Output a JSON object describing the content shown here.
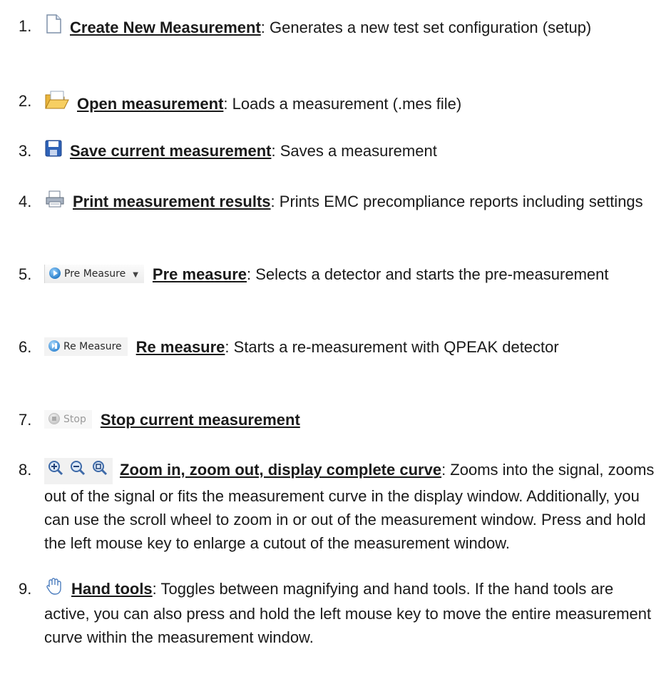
{
  "items": [
    {
      "num": "1.",
      "title": "Create New Measurement",
      "desc": ": Generates a new test set configuration (setup)",
      "icon": "new-document-icon"
    },
    {
      "num": "2.",
      "title": "Open measurement",
      "desc": ": Loads a measurement (.mes file)",
      "icon": "open-folder-icon"
    },
    {
      "num": "3.",
      "title": "Save current measurement",
      "desc": ": Saves a measurement",
      "icon": "floppy-disk-icon"
    },
    {
      "num": "4.",
      "title": "Print measurement results",
      "desc": ": Prints EMC precompliance reports including settings",
      "icon": "printer-icon"
    },
    {
      "num": "5.",
      "title": "Pre measure",
      "desc": ": Selects a detector and starts the pre-measurement",
      "icon": "play-icon",
      "button_label": "Pre Measure"
    },
    {
      "num": "6.",
      "title": "Re measure",
      "desc": ": Starts a re-measurement with QPEAK detector",
      "icon": "replay-icon",
      "button_label": "Re Measure"
    },
    {
      "num": "7.",
      "title": "Stop current measurement",
      "desc": "",
      "icon": "stop-icon",
      "button_label": "Stop"
    },
    {
      "num": "8.",
      "title": "Zoom in, zoom out, display complete curve",
      "desc": ": Zooms into the signal, zooms out of the signal or fits the measurement curve in the display window. Additionally, you can use the scroll wheel to zoom in or out of the measurement window. Press and hold the left mouse key to enlarge a cutout of the measurement window.",
      "icon": "zoom-icons"
    },
    {
      "num": "9.",
      "title": "Hand tools",
      "desc": ": Toggles between magnifying and hand tools. If the hand tools are active, you can also press and hold the left mouse key to move the entire measurement curve within the measurement window.",
      "icon": "hand-icon"
    }
  ]
}
